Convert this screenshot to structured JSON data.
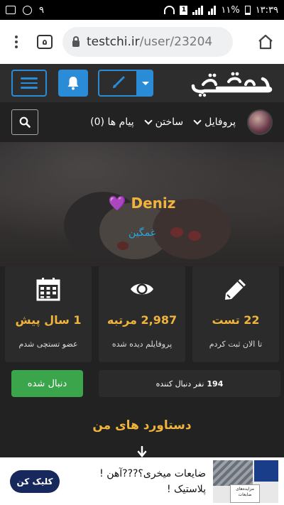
{
  "status_bar": {
    "time": "۱۳:۳۹",
    "battery": "۱۱%",
    "sim": "1",
    "notifications": "۹"
  },
  "browser": {
    "tab_count": "۵",
    "url_domain": "testchi.ir",
    "url_path": "/user/23204"
  },
  "nav": {
    "profile": "پروفایل",
    "build": "ساختن",
    "messages": "پیام ها (0)"
  },
  "hero": {
    "name": "Deniz",
    "name_emoji": "💜",
    "status": "غمگین"
  },
  "stats": [
    {
      "value": "22 تست",
      "label": "تا الان ثبت کردم",
      "icon": "pencil-icon"
    },
    {
      "value": "2,987 مرتبه",
      "label": "پروفایلم دیده شده",
      "icon": "eye-icon"
    },
    {
      "value": "1 سال پیش",
      "label": "عضو تستچی شدم",
      "icon": "calendar-icon"
    }
  ],
  "follow": {
    "button": "دنبال شده",
    "count": "194",
    "followers_text": "نفر دنبال کننده"
  },
  "achievements_title": "دستاورد های من",
  "ad": {
    "line1": "ضایعات میخری؟???آهن !",
    "line2": "پلاستیک !",
    "button": "کلیک کن",
    "image_label": "مزایده‌های ضایعات"
  },
  "colors": {
    "accent_blue": "#2a8bd6",
    "gold": "#f0b43c",
    "green": "#3aa54a",
    "status_blue": "#2aa7e0"
  }
}
